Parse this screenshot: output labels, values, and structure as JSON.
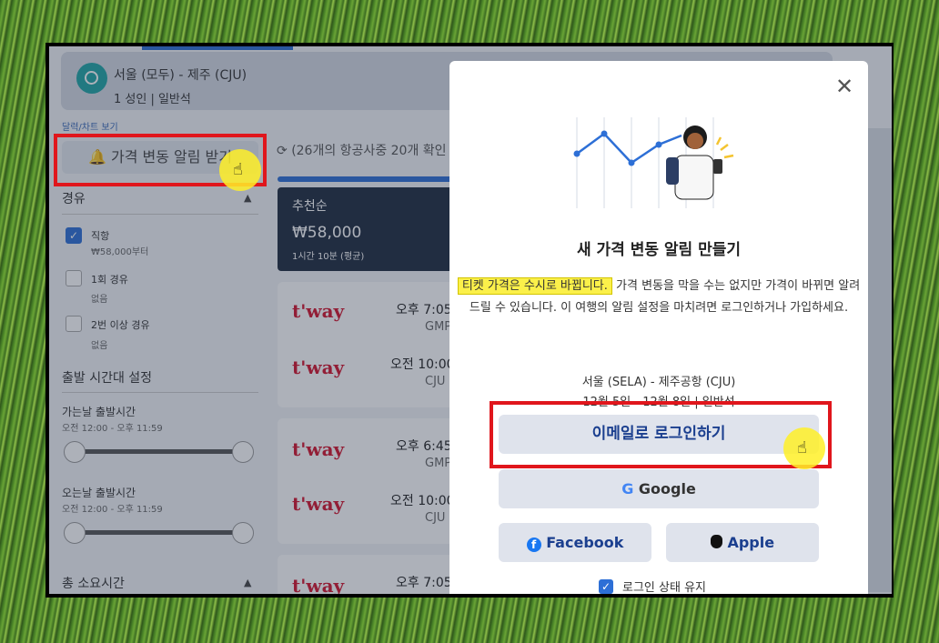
{
  "header": {
    "route": "서울 (모두) - 제주 (CJU)",
    "subroute": "1 성인 | 일반석"
  },
  "sidebar": {
    "calendar_link": "달력/차트 보기",
    "alert_button": "가격 변동 알림 받기",
    "stops_title": "경유",
    "stops": [
      {
        "label": "직항",
        "sub": "₩58,000부터",
        "checked": true
      },
      {
        "label": "1회 경유",
        "sub": "없음",
        "checked": false
      },
      {
        "label": "2번 이상 경유",
        "sub": "없음",
        "checked": false
      }
    ],
    "time_title": "출발 시간대 설정",
    "outbound_label": "가는날 출발시간",
    "outbound_range": "오전 12:00 - 오후 11:59",
    "return_label": "오는날 출발시간",
    "return_range": "오전 12:00 - 오후 11:59",
    "duration_title": "총 소요시간"
  },
  "results": {
    "status": "(26개의 항공사중 20개 확인",
    "recommended_label": "추천순",
    "recommended_price": "₩58,000",
    "recommended_duration": "1시간 10분 (평균)",
    "airline": "t'way",
    "flights": [
      {
        "out_time": "오후 7:05",
        "out_code": "GMP",
        "ret_time": "오전 10:00",
        "ret_code": "CJU"
      },
      {
        "out_time": "오후 6:45",
        "out_code": "GMP",
        "ret_time": "오전 10:00",
        "ret_code": "CJU"
      },
      {
        "out_time": "오후 7:05"
      }
    ]
  },
  "modal": {
    "close": "✕",
    "title": "새 가격 변동 알림 만들기",
    "highlight": "티켓 가격은 수시로 바뀝니다.",
    "body": "가격 변동을 막을 수는 없지만 가격이 바뀌면 알려드릴 수 있습니다. 이 여행의 알림 설정을 마치려면 로그인하거나 가입하세요.",
    "route": "서울 (SELA) - 제주공항 (CJU)",
    "dates": "12월 5일 - 12월 8일 | 일반석",
    "email_button": "이메일로 로그인하기",
    "google_button": "Google",
    "facebook_button": "Facebook",
    "apple_button": "Apple",
    "keep_signed_in": "로그인 상태 유지"
  },
  "colors": {
    "accent": "#2d6fd6",
    "highlight": "#fbf04a",
    "annotation_red": "#e0161c"
  }
}
